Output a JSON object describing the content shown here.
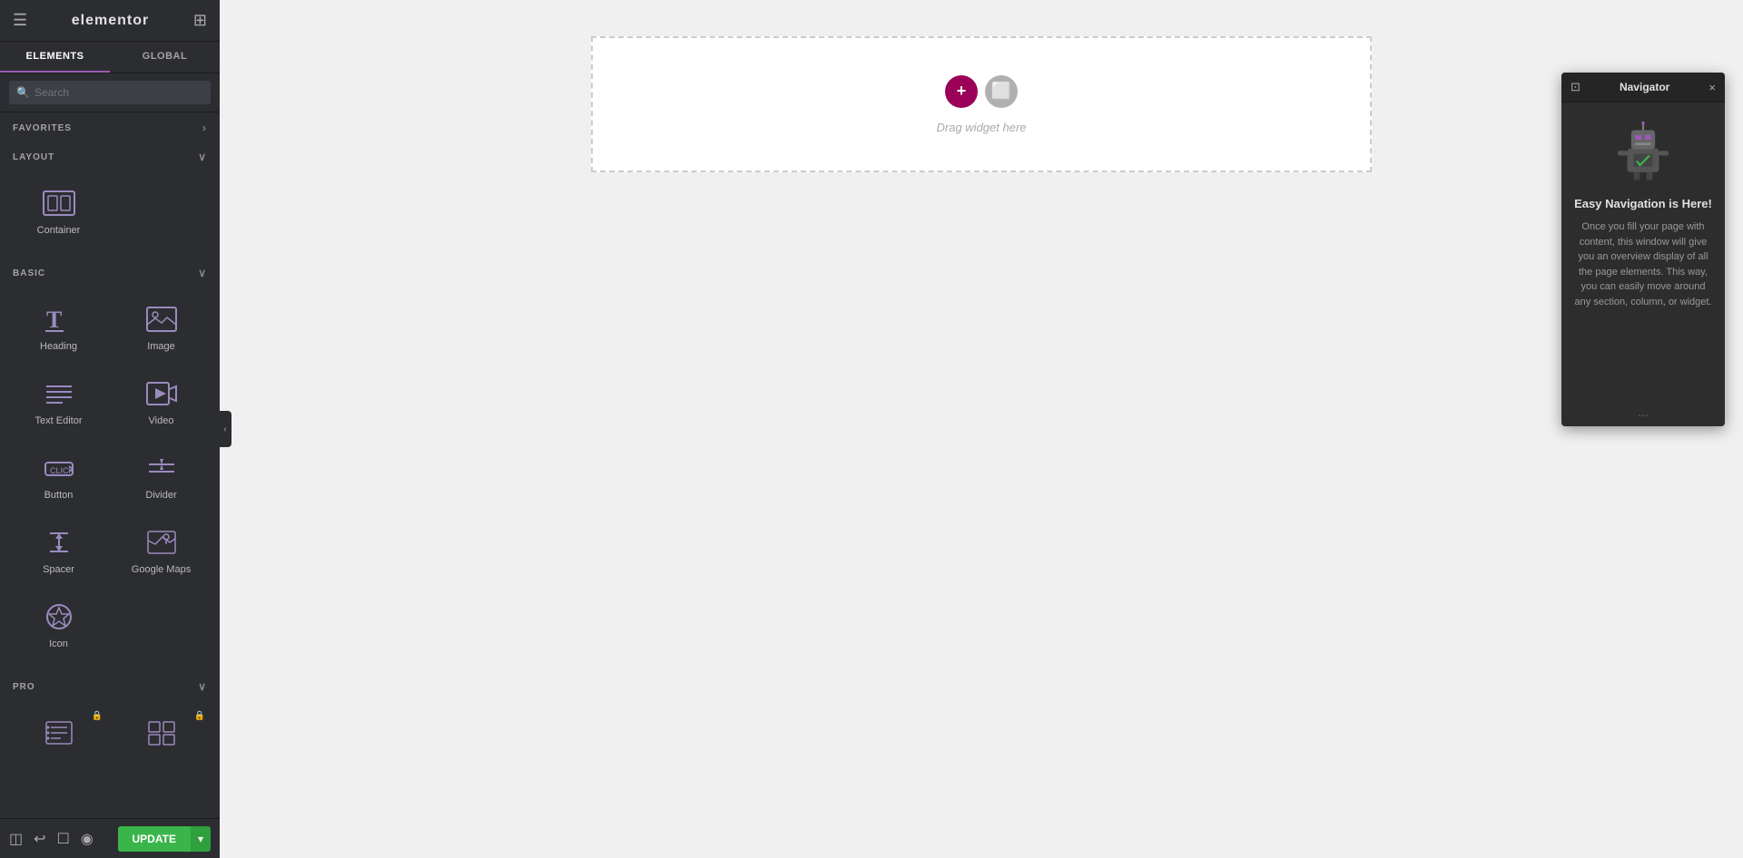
{
  "header": {
    "menu_icon": "☰",
    "logo": "elementor",
    "grid_icon": "⊞"
  },
  "tabs": [
    {
      "id": "elements",
      "label": "ELEMENTS",
      "active": true
    },
    {
      "id": "global",
      "label": "GLOBAL",
      "active": false
    }
  ],
  "search": {
    "placeholder": "Search"
  },
  "sections": {
    "favorites": {
      "label": "FAVORITES",
      "chevron": "›"
    },
    "layout": {
      "label": "LAYOUT",
      "chevron": "∨",
      "items": [
        {
          "id": "container",
          "label": "Container",
          "icon": "container"
        }
      ]
    },
    "basic": {
      "label": "BASIC",
      "chevron": "∨",
      "items": [
        {
          "id": "heading",
          "label": "Heading",
          "icon": "heading"
        },
        {
          "id": "image",
          "label": "Image",
          "icon": "image"
        },
        {
          "id": "text-editor",
          "label": "Text Editor",
          "icon": "text-editor"
        },
        {
          "id": "video",
          "label": "Video",
          "icon": "video"
        },
        {
          "id": "button",
          "label": "Button",
          "icon": "button"
        },
        {
          "id": "divider",
          "label": "Divider",
          "icon": "divider"
        },
        {
          "id": "spacer",
          "label": "Spacer",
          "icon": "spacer"
        },
        {
          "id": "google-maps",
          "label": "Google Maps",
          "icon": "google-maps"
        },
        {
          "id": "icon",
          "label": "Icon",
          "icon": "icon"
        }
      ]
    },
    "pro": {
      "label": "PRO",
      "chevron": "∨",
      "items": [
        {
          "id": "pro-list",
          "label": "",
          "icon": "pro-list",
          "locked": true
        },
        {
          "id": "pro-grid",
          "label": "",
          "icon": "pro-grid",
          "locked": true
        }
      ]
    }
  },
  "canvas": {
    "add_btn": "+",
    "layout_btn": "⬜",
    "hint": "Drag widget here"
  },
  "navigator": {
    "title": "Navigator",
    "close_icon": "×",
    "resize_icon": "⊡",
    "heading": "Easy Navigation is Here!",
    "description_parts": [
      "Once you fill your page with content, this window will give you an overview display of all the page elements. This way, you can easily move around any section, column, or widget.",
      "section",
      "column",
      "widget"
    ],
    "description": "Once you fill your page with content, this window will give you an overview display of all the page elements. This way, you can easily move around any section, column, or widget.",
    "dots": "..."
  },
  "footer": {
    "history_icon": "↩",
    "settings_icon": "⚙",
    "layers_icon": "◫",
    "preview_icon": "◉",
    "responsive_icon": "☐",
    "update_label": "UPDATE",
    "update_arrow": "▾"
  },
  "colors": {
    "sidebar_bg": "#2c2d30",
    "accent_purple": "#9b59b6",
    "accent_red": "#9b0059",
    "accent_green": "#39b54a",
    "widget_icon": "#9b8abf",
    "navigator_bg": "#2d2d2d",
    "navigator_desc_highlight": "#c0a0d0"
  }
}
